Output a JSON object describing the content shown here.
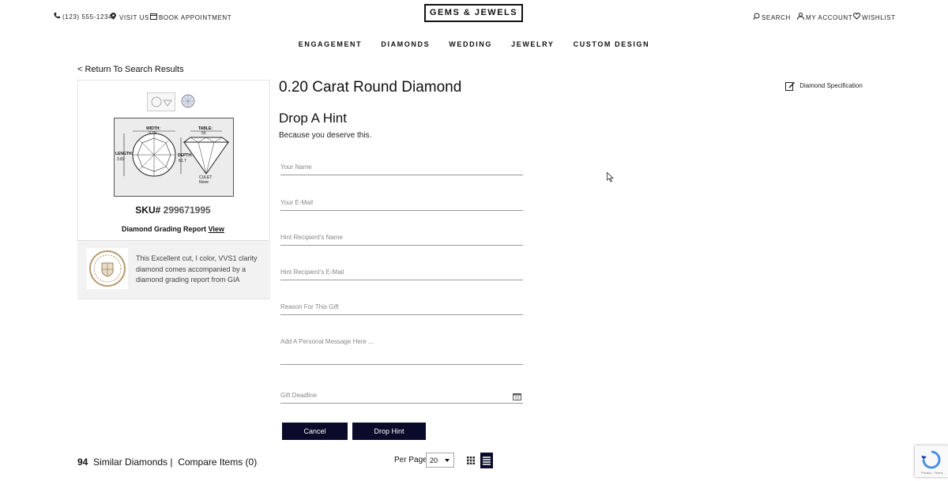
{
  "header": {
    "phone": "(123) 555-1234",
    "visit": "VISIT US",
    "appointment": "BOOK APPOINTMENT",
    "logo": "GEMS & JEWELS",
    "search": "SEARCH",
    "account": "MY ACCOUNT",
    "wishlist": "WISHLIST"
  },
  "nav": [
    "ENGAGEMENT",
    "DIAMONDS",
    "WEDDING",
    "JEWELRY",
    "CUSTOM DESIGN"
  ],
  "back_link": "< Return To Search Results",
  "diagram": {
    "width_label": "WIDTH:",
    "width_val": "3.79",
    "table_label": "TABLE:",
    "table_val": "55",
    "length_label": "LENGTH:",
    "length_val": "3.82",
    "depth_label": "DEPTH:",
    "depth_val": "61.7",
    "culet_label": "CULET",
    "culet_val": "None"
  },
  "sku": {
    "label": "SKU#",
    "number": "299671995"
  },
  "report": {
    "label": "Diamond Grading Report",
    "link": "View"
  },
  "gia_text": "This Excellent cut, I color, VVS1 clarity diamond comes accompanied by a diamond grading report from GIA",
  "product_title": "0.20 Carat Round Diamond",
  "spec_link": "Diamond Specification",
  "hint": {
    "heading": "Drop A Hint",
    "subheading": "Because you deserve this.",
    "fields": {
      "name": "Your Name",
      "email": "Your E-Mail",
      "recipient_name": "Hint Recipient's Name",
      "recipient_email": "Hint Recipient's E-Mail",
      "reason": "Reason For This Gift",
      "message": "Add A Personal Message Here ...",
      "deadline": "Gift Deadline"
    },
    "cancel": "Cancel",
    "submit": "Drop Hint"
  },
  "footer": {
    "count": "94",
    "similar": "Similar Diamonds |",
    "compare": "Compare Items (0)",
    "per_page_label": "Per Page",
    "per_page_value": "20"
  },
  "colors": {
    "button_bg": "#0a0a2a",
    "text": "#111111"
  }
}
